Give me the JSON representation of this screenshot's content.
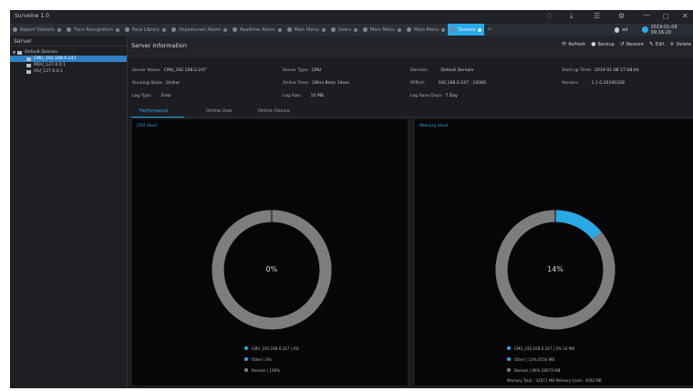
{
  "window": {
    "title": "Surveine 1.0"
  },
  "tabs": [
    {
      "label": "Report Statistic"
    },
    {
      "label": "Face Recognition"
    },
    {
      "label": "Face Library"
    },
    {
      "label": "Impostunan Alarm"
    },
    {
      "label": "Realtime Alarm"
    },
    {
      "label": "Main Menu"
    },
    {
      "label": "Users"
    },
    {
      "label": "Main Menu"
    },
    {
      "label": "Main Menu"
    },
    {
      "label": "Servers",
      "active": true
    }
  ],
  "tab_more": "+",
  "user": {
    "name": "ad",
    "datetime": "2019-01-08 09:16:20"
  },
  "sidebar": {
    "header": "Server",
    "root": "Default Domain",
    "items": [
      {
        "label": "CMU_192.168.0.247",
        "selected": true
      },
      {
        "label": "MDU_127.0.0.1"
      },
      {
        "label": "IAU_127.0.0.1"
      }
    ]
  },
  "content": {
    "title": "Server Information",
    "toolbar": {
      "refresh": "Refresh",
      "backup": "Backup",
      "restore": "Restore",
      "edit": "Edit",
      "delete": "Delete"
    },
    "info": {
      "server_name_label": "Server Name:",
      "server_name": "CMU_192.168.0.247",
      "server_type_label": "Server Type:",
      "server_type": "CMU",
      "domain_label": "Domain:",
      "domain": "Default Domain",
      "startup_label": "Start-up Time:",
      "startup": "2019-01-08 17:08:44",
      "running_label": "Running State:",
      "running": "Online",
      "online_time_label": "Online Time:",
      "online_time": "18hrs 8min 14sec",
      "ipport_label": "IP/Port:",
      "ipport": "192.168.0.247 : 10080",
      "version_label": "Version:",
      "version": "1.1.0.20190328",
      "logtype_label": "Log Type:",
      "logtype": "Error",
      "logsize_label": "Log Size:",
      "logsize": "10 MB",
      "logsave_label": "Log Save Days:",
      "logsave": "7 Day"
    },
    "subtabs": [
      "Performance",
      "Online User",
      "Online Device"
    ]
  },
  "cpu_panel": {
    "title": "CPU Used",
    "center_label": "0%",
    "legend": [
      {
        "text": "CMU_192.168.0.247 | 0%",
        "color": "#2aa9e8"
      },
      {
        "text": "Other | 0%",
        "color": "#2aa9e8"
      },
      {
        "text": "Remain | 100%",
        "color": "#7d7d7d"
      }
    ]
  },
  "mem_panel": {
    "title": "Memory Used",
    "center_label": "14%",
    "legend": [
      {
        "text": "CMU_192.168.0.247 | 0% 34 MB",
        "color": "#2aa9e8"
      },
      {
        "text": "Other | 14% 4556 MB",
        "color": "#2aa9e8"
      },
      {
        "text": "Remain | 86% 28079 MB",
        "color": "#7d7d7d"
      }
    ],
    "total": "Memory Total : 32071 MB  Memory Used : 4592 MB"
  },
  "colors": {
    "accent": "#2aa9e8",
    "remain": "#7d7d7d"
  },
  "chart_data": [
    {
      "type": "pie",
      "title": "CPU Used",
      "categories": [
        "CMU_192.168.0.247",
        "Other",
        "Remain"
      ],
      "values": [
        0,
        0,
        100
      ],
      "center_label": "0%"
    },
    {
      "type": "pie",
      "title": "Memory Used",
      "categories": [
        "CMU_192.168.0.247",
        "Other",
        "Remain"
      ],
      "values": [
        0,
        14,
        86
      ],
      "center_label": "14%"
    }
  ]
}
